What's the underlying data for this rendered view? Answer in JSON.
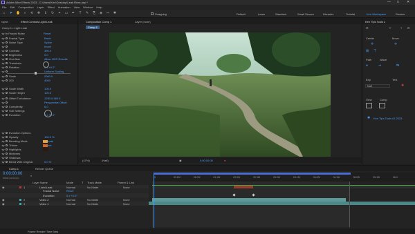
{
  "window": {
    "title": "Adobe After Effects 2023 - C:\\Users\\Ken\\Desktop\\Leak Rees.aep *",
    "controls": [
      "—",
      "□",
      "✕"
    ]
  },
  "menu": [
    "File",
    "Edit",
    "Composition",
    "Layer",
    "Effect",
    "Animation",
    "View",
    "Window",
    "Help"
  ],
  "toolbar": {
    "snapping_label": "Snapping",
    "workspaces": [
      "Default",
      "Learn",
      "Standard",
      "Small Screen",
      "Libraries",
      "Tutorial",
      "Ken Workspace",
      "Review"
    ],
    "active_workspace": "Ken Workspace"
  },
  "effect_controls": {
    "tab_project": "roject",
    "tab_label": "Effect Controls Light Leak",
    "breadcrumb": "Comp 1 • Light Leak",
    "effect_name": "Fractal Noise",
    "reset": "Reset",
    "properties": [
      {
        "label": "Fractal Type",
        "value": "Basic"
      },
      {
        "label": "Noise Type",
        "value": "Spline"
      },
      {
        "label": "",
        "value": "Invert"
      },
      {
        "label": "Contrast",
        "value": "390.0"
      },
      {
        "label": "Brightness",
        "value": "0.0"
      },
      {
        "label": "Overflow",
        "value": "Allow HDR Results"
      },
      {
        "label": "Transform",
        "value": ""
      },
      {
        "label": "Rotation",
        "value": "0 x +0.0°"
      },
      {
        "label": "",
        "value": "Uniform Scaling"
      },
      {
        "label": "Scale",
        "value": "2000.0"
      },
      {
        "label": "200",
        "value": "4000"
      },
      {
        "label": "Scale Width",
        "value": "100.0"
      },
      {
        "label": "Scale Height",
        "value": "100.0"
      },
      {
        "label": "Offset Turbulence",
        "value": "1280.0,360.0"
      },
      {
        "label": "",
        "value": "Perspective Offset"
      },
      {
        "label": "Complexity",
        "value": "6.0"
      },
      {
        "label": "Sub Settings",
        "value": ""
      },
      {
        "label": "Evolution",
        "value": "0 x +0.0°"
      },
      {
        "label": "Evolution Options",
        "value": ""
      },
      {
        "label": "Opacity",
        "value": "100.0 %"
      },
      {
        "label": "Blending Mode",
        "value": "Normal"
      },
      {
        "label": "Tritone",
        "value": "Reset"
      },
      {
        "label": "Highlights",
        "value": ""
      },
      {
        "label": "Midtones",
        "value": ""
      },
      {
        "label": "Shadows",
        "value": ""
      },
      {
        "label": "Blend With Original",
        "value": "0.0 %"
      },
      {
        "label": "Gaussian Blur",
        "value": "Reset"
      }
    ],
    "swatch_colors": [
      "#e8a13a",
      "#d7641d",
      "#2a1a10"
    ]
  },
  "composition": {
    "tab_label": "Composition Comp 1",
    "layer_tab": "Layer (none)",
    "comp_tab": "Comp 1",
    "footer": {
      "zoom": "(47%)",
      "quality": "(Half)",
      "timecode": "0:00:00:00"
    }
  },
  "right_panel": {
    "title": "Ken Tips Tools 2",
    "section_align": "Center",
    "section_move": "Move",
    "section_path": "Path",
    "section_wave": "Wave",
    "section_exp": "Exp",
    "section_text": "Text",
    "exp_field": "Null",
    "section_view": "View",
    "section_comp": "Comp",
    "footer": "Ken Tips Tools v2.2023"
  },
  "timeline": {
    "tab_comp": "Comp 1",
    "tab_render": "Render Queue",
    "timecode": "0:00:00:00",
    "timecode_sub": "00000 (30.00 fps)",
    "columns": [
      "Layer Name",
      "Mode",
      "T",
      "Track Matte",
      "Parent & Link"
    ],
    "layers": [
      {
        "num": "1",
        "name": "Light Leak",
        "mode": "Normal",
        "matte": "No Matte",
        "parent": "None",
        "color": "#c03535"
      },
      {
        "num": "",
        "name": "Fractal Noise",
        "mode": "Reset",
        "matte": "",
        "parent": "",
        "color": ""
      },
      {
        "num": "",
        "name": "Evolution",
        "mode": "0 x +0.0°",
        "matte": "",
        "parent": "",
        "color": ""
      },
      {
        "num": "2",
        "name": "Video 2",
        "mode": "Normal",
        "matte": "No Matte",
        "parent": "None",
        "color": "#3fa8a8"
      },
      {
        "num": "3",
        "name": "Video 1",
        "mode": "Normal",
        "matte": "No Matte",
        "parent": "None",
        "color": "#3fa8a8"
      }
    ],
    "ruler": [
      "0f",
      "00:15f",
      "01:00f",
      "01:15f",
      "02:00f",
      "02:15f",
      "03:00f",
      "03:15f",
      "04:00f",
      "04:15f",
      "05:00f",
      "05:15f",
      "06:0"
    ],
    "footer": "Frame Render Time 0ms"
  }
}
